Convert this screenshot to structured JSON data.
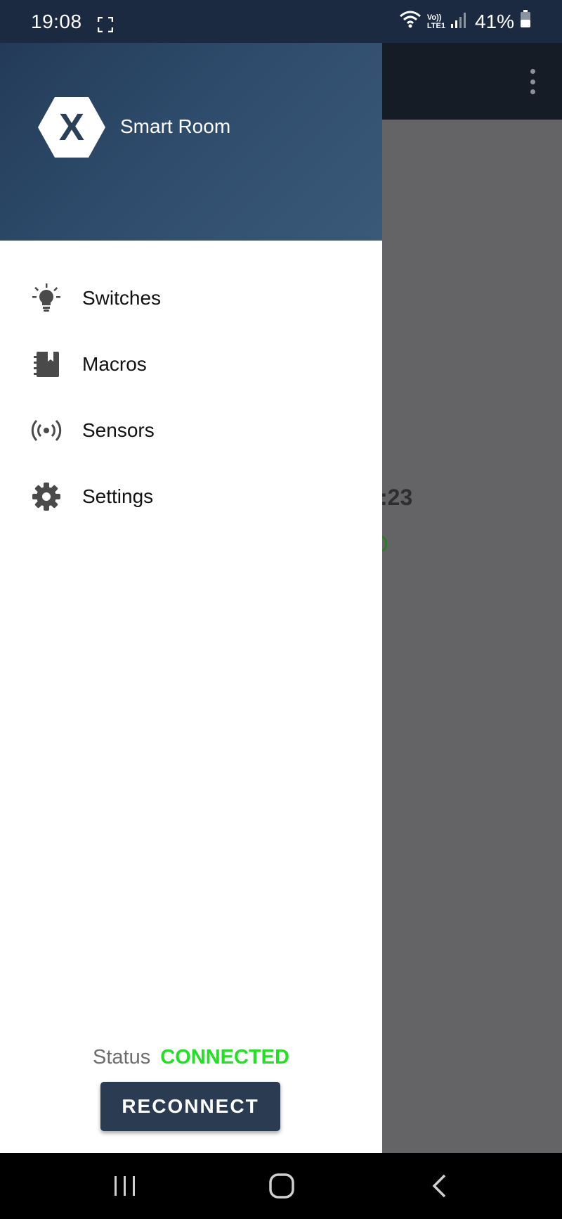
{
  "status_bar": {
    "time": "19:08",
    "network_label_top": "Vo))",
    "network_label_bottom": "LTE1",
    "battery_percent": "41%"
  },
  "background_app": {
    "partial_time": ":23"
  },
  "drawer": {
    "app_name": "Smart Room",
    "logo_letter": "X",
    "menu_items": [
      {
        "label": "Switches",
        "icon": "lightbulb-icon"
      },
      {
        "label": "Macros",
        "icon": "macros-book-icon"
      },
      {
        "label": "Sensors",
        "icon": "sensor-broadcast-icon"
      },
      {
        "label": "Settings",
        "icon": "gear-icon"
      }
    ],
    "status_label": "Status",
    "status_value": "CONNECTED",
    "reconnect_label": "RECONNECT"
  },
  "colors": {
    "header_bg": "#2e4b6b",
    "status_connected": "#22e022",
    "button_bg": "#2b3b52",
    "scrim": "#646467"
  }
}
